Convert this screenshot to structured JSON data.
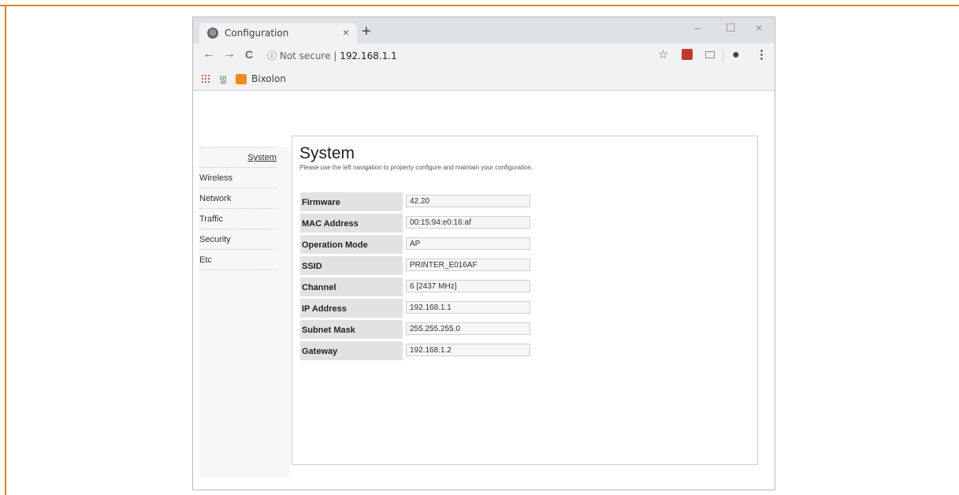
{
  "browser": {
    "tab": {
      "title": "Configuration",
      "icon": "globe-icon",
      "close": "×"
    },
    "new_tab": "+",
    "window_controls": {
      "minimize": "–",
      "maximize": "☐",
      "close": "×"
    },
    "toolbar": {
      "back": "←",
      "forward": "→",
      "reload": "C",
      "security_icon": "ⓘ",
      "security_text": "Not secure",
      "separator": "|",
      "url": "192.168.1.1",
      "star": "☆",
      "account": "●",
      "menu": "⋮"
    },
    "bookmarks": {
      "small_item": "멀",
      "bixolon_label": "Bixolon"
    }
  },
  "sidebar": {
    "items": [
      {
        "label": "System",
        "active": true
      },
      {
        "label": "Wireless"
      },
      {
        "label": "Network"
      },
      {
        "label": "Traffic"
      },
      {
        "label": "Security"
      },
      {
        "label": "Etc"
      }
    ]
  },
  "main": {
    "title": "System",
    "description": "Please use the left navigation to property configure and maintain your configuration.",
    "rows": [
      {
        "label": "Firmware",
        "value": "42.20"
      },
      {
        "label": "MAC Address",
        "value": "00:15:94:e0:16:af"
      },
      {
        "label": "Operation Mode",
        "value": "AP"
      },
      {
        "label": "SSID",
        "value": "PRINTER_E016AF"
      },
      {
        "label": "Channel",
        "value": "6 [2437 MHz]"
      },
      {
        "label": "IP Address",
        "value": "192.168.1.1"
      },
      {
        "label": "Subnet Mask",
        "value": "255.255.255.0"
      },
      {
        "label": "Gateway",
        "value": "192.168.1.2"
      }
    ]
  },
  "colors": {
    "frame": "#d9822b",
    "bixolon_icon": "#f08c1e",
    "label_bg": "#e2e2e2"
  }
}
